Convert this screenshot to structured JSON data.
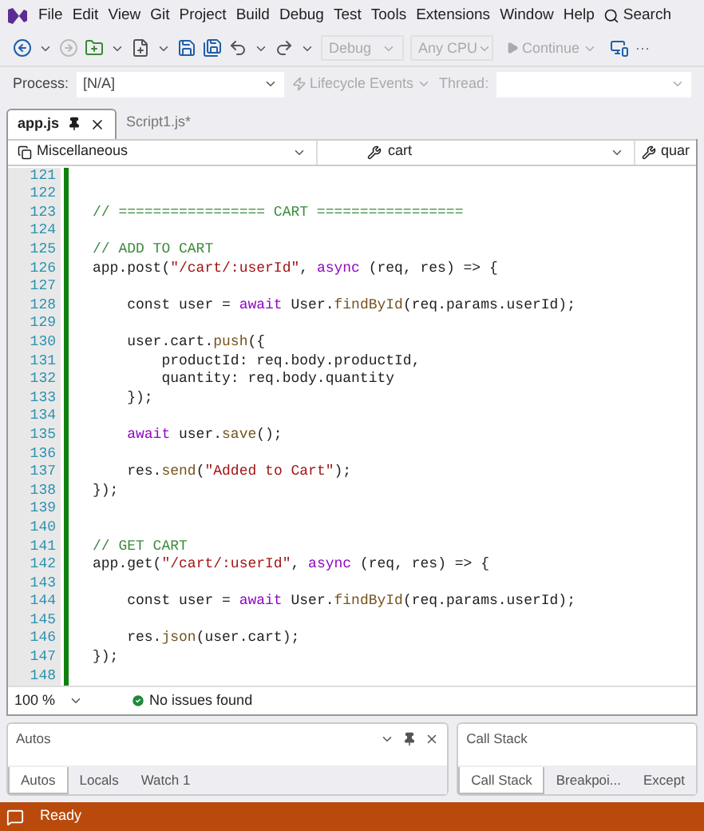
{
  "menu_bar": {
    "items": [
      "File",
      "Edit",
      "View",
      "Git",
      "Project",
      "Build",
      "Debug",
      "Test",
      "Tools",
      "Extensions",
      "Window",
      "Help"
    ],
    "search": "Search"
  },
  "toolbar": {
    "configuration": {
      "value": "Debug",
      "disabled": true
    },
    "platform": {
      "value": "Any CPU",
      "disabled": true
    },
    "continue": {
      "label": "Continue",
      "disabled": true
    },
    "overflow": "···"
  },
  "debug_location": {
    "process_label": "Process:",
    "process_value": "[N/A]",
    "lifecycle": {
      "label": "Lifecycle Events",
      "disabled": true
    },
    "thread_label": "Thread:"
  },
  "tabs": [
    {
      "label": "app.js",
      "selected": true,
      "pinned": true
    },
    {
      "label": "Script1.js*",
      "selected": false,
      "pinned": false
    }
  ],
  "navigation_bar": {
    "project": "Miscellaneous",
    "scope": "cart",
    "member": "quar"
  },
  "editor": {
    "lines": [
      {
        "number": "121"
      },
      {
        "number": "122"
      },
      {
        "number": "123",
        "segments": [
          {
            "kind": "comment",
            "text": "// ================= CART ================="
          }
        ]
      },
      {
        "number": "124"
      },
      {
        "number": "125",
        "segments": [
          {
            "kind": "comment",
            "text": "// ADD TO CART"
          }
        ]
      },
      {
        "number": "126",
        "segments": [
          {
            "kind": "plain",
            "text": "app.post("
          },
          {
            "kind": "string",
            "text": "\"/cart/:userId\""
          },
          {
            "kind": "plain",
            "text": ", "
          },
          {
            "kind": "keyword",
            "text": "async"
          },
          {
            "kind": "plain",
            "text": " (req, res) => {"
          }
        ]
      },
      {
        "number": "127"
      },
      {
        "number": "128",
        "segments": [
          {
            "kind": "plain",
            "text": "    const user = "
          },
          {
            "kind": "keyword",
            "text": "await"
          },
          {
            "kind": "plain",
            "text": " User."
          },
          {
            "kind": "method",
            "text": "findById"
          },
          {
            "kind": "plain",
            "text": "(req.params.userId);"
          }
        ]
      },
      {
        "number": "129"
      },
      {
        "number": "130",
        "segments": [
          {
            "kind": "plain",
            "text": "    user.cart."
          },
          {
            "kind": "method",
            "text": "push"
          },
          {
            "kind": "plain",
            "text": "({"
          }
        ]
      },
      {
        "number": "131",
        "segments": [
          {
            "kind": "plain",
            "text": "        productId: req.body.productId,"
          }
        ]
      },
      {
        "number": "132",
        "segments": [
          {
            "kind": "plain",
            "text": "        quantity: req.body.quantity"
          }
        ]
      },
      {
        "number": "133",
        "segments": [
          {
            "kind": "plain",
            "text": "    });"
          }
        ]
      },
      {
        "number": "134"
      },
      {
        "number": "135",
        "segments": [
          {
            "kind": "keyword",
            "text": "    await"
          },
          {
            "kind": "plain",
            "text": " user."
          },
          {
            "kind": "method",
            "text": "save"
          },
          {
            "kind": "plain",
            "text": "();"
          }
        ]
      },
      {
        "number": "136"
      },
      {
        "number": "137",
        "segments": [
          {
            "kind": "plain",
            "text": "    res."
          },
          {
            "kind": "method",
            "text": "send"
          },
          {
            "kind": "plain",
            "text": "("
          },
          {
            "kind": "string",
            "text": "\"Added to Cart\""
          },
          {
            "kind": "plain",
            "text": ");"
          }
        ]
      },
      {
        "number": "138",
        "segments": [
          {
            "kind": "plain",
            "text": "});"
          }
        ]
      },
      {
        "number": "139"
      },
      {
        "number": "140"
      },
      {
        "number": "141",
        "segments": [
          {
            "kind": "comment",
            "text": "// GET CART"
          }
        ]
      },
      {
        "number": "142",
        "segments": [
          {
            "kind": "plain",
            "text": "app.get("
          },
          {
            "kind": "string",
            "text": "\"/cart/:userId\""
          },
          {
            "kind": "plain",
            "text": ", "
          },
          {
            "kind": "keyword",
            "text": "async"
          },
          {
            "kind": "plain",
            "text": " (req, res) => {"
          }
        ]
      },
      {
        "number": "143"
      },
      {
        "number": "144",
        "segments": [
          {
            "kind": "plain",
            "text": "    const user = "
          },
          {
            "kind": "keyword",
            "text": "await"
          },
          {
            "kind": "plain",
            "text": " User."
          },
          {
            "kind": "method",
            "text": "findById"
          },
          {
            "kind": "plain",
            "text": "(req.params.userId);"
          }
        ]
      },
      {
        "number": "145"
      },
      {
        "number": "146",
        "segments": [
          {
            "kind": "plain",
            "text": "    res."
          },
          {
            "kind": "method",
            "text": "json"
          },
          {
            "kind": "plain",
            "text": "(user.cart);"
          }
        ]
      },
      {
        "number": "147",
        "segments": [
          {
            "kind": "plain",
            "text": "});"
          }
        ]
      },
      {
        "number": "148"
      }
    ]
  },
  "editor_status": {
    "zoom": "100 %",
    "issues": "No issues found"
  },
  "panels": [
    {
      "title": "Autos",
      "tabs": [
        {
          "label": "Autos",
          "selected": true
        },
        {
          "label": "Locals",
          "selected": false
        },
        {
          "label": "Watch 1",
          "selected": false
        }
      ]
    },
    {
      "title": "Call Stack",
      "tabs": [
        {
          "label": "Call Stack",
          "selected": true
        },
        {
          "label": "Breakpoi...",
          "selected": false
        },
        {
          "label": "Except",
          "selected": false
        }
      ]
    }
  ],
  "status_bar": {
    "text": "Ready"
  }
}
